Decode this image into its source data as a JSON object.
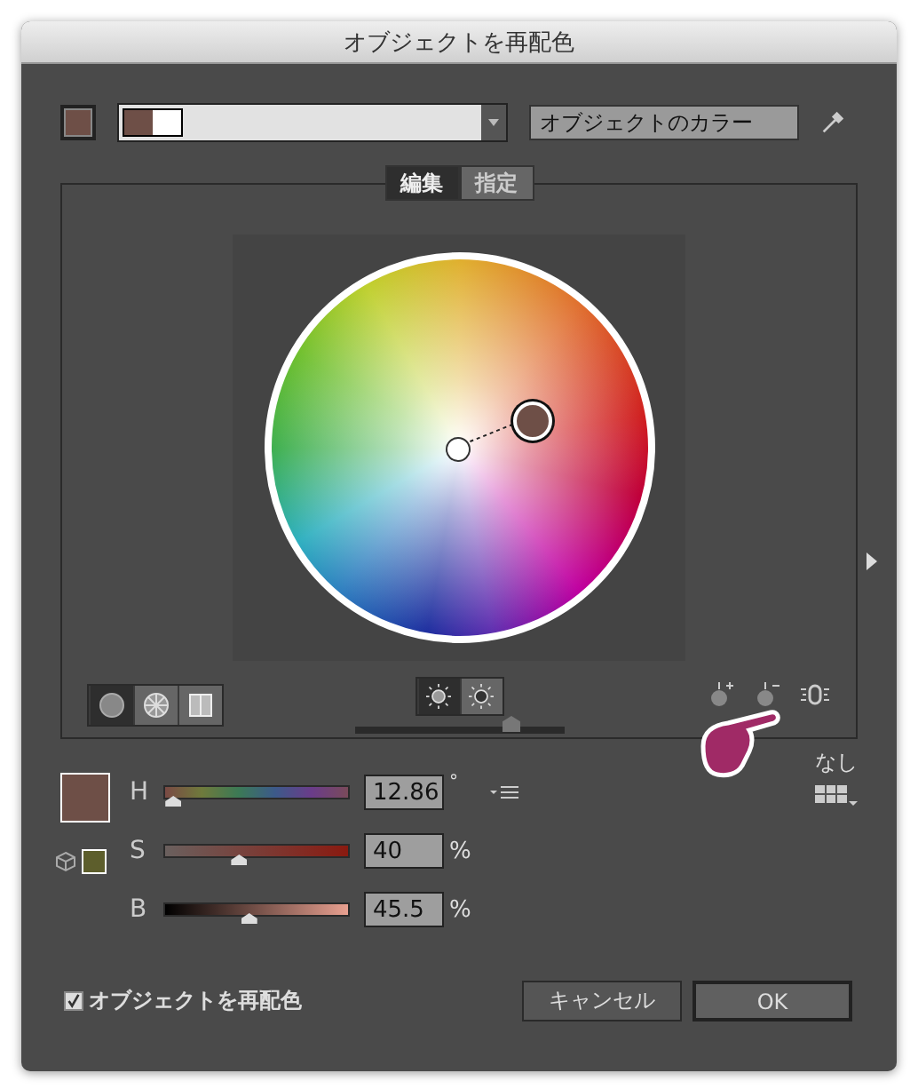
{
  "window": {
    "title": "オブジェクトを再配色"
  },
  "top_bar": {
    "source": "オブジェクトのカラー"
  },
  "tabs": [
    {
      "label": "編集",
      "selected": true
    },
    {
      "label": "指定",
      "selected": false
    }
  ],
  "view_modes": [
    {
      "kind": "smooth",
      "selected": true
    },
    {
      "kind": "segmented",
      "selected": false
    },
    {
      "kind": "bars",
      "selected": false
    }
  ],
  "display_modes": [
    {
      "kind": "brightness",
      "selected": true
    },
    {
      "kind": "saturation",
      "selected": false
    }
  ],
  "wheel_slider": {
    "level": 0.75
  },
  "none_label": "なし",
  "channels": [
    {
      "label": "H",
      "kind": "hue",
      "value": "12.86",
      "unit": "°",
      "level": 0.04
    },
    {
      "label": "S",
      "kind": "saturation",
      "value": "40",
      "unit": "%",
      "level": 0.4
    },
    {
      "label": "B",
      "kind": "brightness",
      "value": "45.5",
      "unit": "%",
      "level": 0.455
    }
  ],
  "recolor_checkbox": {
    "label": "オブジェクトを再配色",
    "checked": true
  },
  "buttons": [
    {
      "label": "キャンセル",
      "kind": "cancel"
    },
    {
      "label": "OK",
      "kind": "default"
    }
  ]
}
